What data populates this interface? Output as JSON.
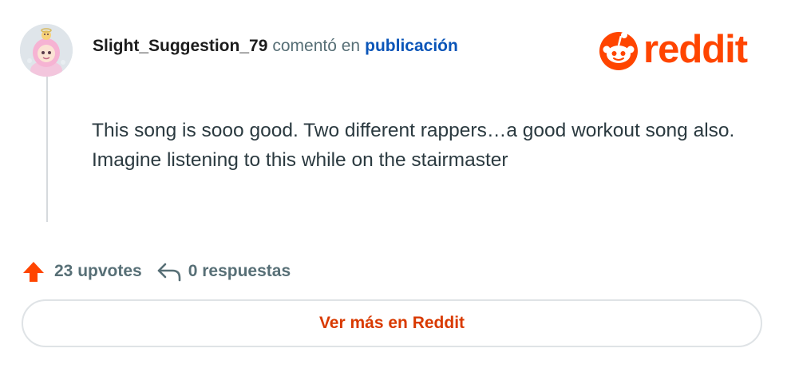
{
  "comment": {
    "username": "Slight_Suggestion_79",
    "commented_in": "comentó en",
    "post_link": "publicación",
    "body": "This song is sooo good. Two different rappers…a good workout song also. Imagine listening to this while on the stairmaster"
  },
  "brand": {
    "wordmark": "reddit",
    "color": "#ff4500"
  },
  "actions": {
    "upvotes": "23 upvotes",
    "replies": "0 respuestas",
    "upvote_color": "#ff4500"
  },
  "cta": {
    "label": "Ver más en Reddit",
    "color": "#d93a00"
  }
}
